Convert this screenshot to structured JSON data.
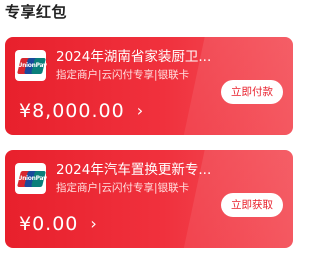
{
  "section_title": "专享红包",
  "cards": [
    {
      "logo_text": "UnionPay",
      "title": "2024年湖南省家装厨卫...",
      "subtitle": "指定商户|云闪付专享|银联卡",
      "amount": "¥8,000.00",
      "chevron": "›",
      "button_label": "立即付款"
    },
    {
      "logo_text": "UnionPay",
      "title": "2024年汽车置换更新专...",
      "subtitle": "指定商户|云闪付专享|银联卡",
      "amount": "¥0.00",
      "chevron": "›",
      "button_label": "立即获取"
    }
  ],
  "colors": {
    "card_red": "#e8202c",
    "button_text": "#e8202c",
    "title_text": "#222222"
  }
}
